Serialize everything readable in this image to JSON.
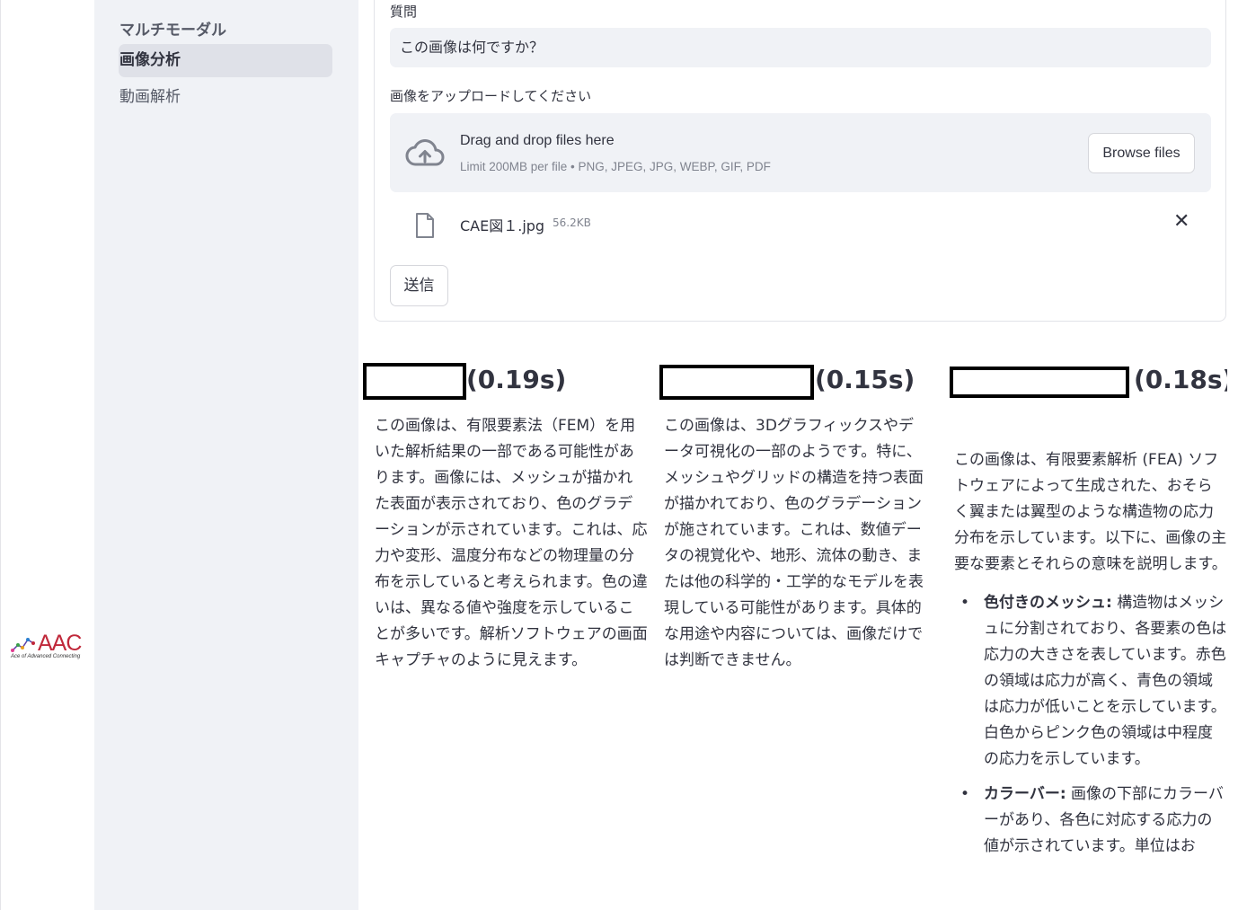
{
  "branding": {
    "logo_text": "AAC",
    "logo_tagline": "Ace of Advanced Connecting"
  },
  "sidebar": {
    "section_heading": "マルチモーダル",
    "items": [
      {
        "label": "画像分析",
        "active": true
      },
      {
        "label": "動画解析",
        "active": false
      }
    ]
  },
  "form": {
    "question_label": "質問",
    "question_value": "この画像は何ですか？",
    "upload_label": "画像をアップロードしてください",
    "dropzone": {
      "main_text": "Drag and drop files here",
      "limit_text": "Limit 200MB per file • PNG, JPEG, JPG, WEBP, GIF, PDF",
      "browse_label": "Browse files",
      "icon": "cloud-upload-icon"
    },
    "uploaded_file": {
      "name": "CAE図１.jpg",
      "size": "56.2KB",
      "icon": "file-icon",
      "remove_icon": "close-icon"
    },
    "submit_label": "送信"
  },
  "results": [
    {
      "timing": "(0.19s)",
      "paragraphs": [
        "この画像は、有限要素法（FEM）を用いた解析結果の一部である可能性があります。画像には、メッシュが描かれた表面が表示されており、色のグラデーションが示されています。これは、応力や変形、温度分布などの物理量の分布を示していると考えられます。色の違いは、異なる値や強度を示していることが多いです。解析ソフトウェアの画面キャプチャのように見えます。"
      ]
    },
    {
      "timing": "(0.15s)",
      "paragraphs": [
        "この画像は、3Dグラフィックスやデータ可視化の一部のようです。特に、メッシュやグリッドの構造を持つ表面が描かれており、色のグラデーションが施されています。これは、数値データの視覚化や、地形、流体の動き、または他の科学的・工学的なモデルを表現している可能性があります。具体的な用途や内容については、画像だけでは判断できません。"
      ]
    },
    {
      "timing": "(0.18s)",
      "paragraphs": [
        "この画像は、有限要素解析 (FEA) ソフトウェアによって生成された、おそらく翼または翼型のような構造物の応力分布を示しています。以下に、画像の主要な要素とそれらの意味を説明します。"
      ],
      "bullets": [
        {
          "term": "色付きのメッシュ:",
          "text": " 構造物はメッシュに分割されており、各要素の色は応力の大きさを表しています。赤色の領域は応力が高く、青色の領域は応力が低いことを示しています。白色からピンク色の領域は中程度の応力を示しています。"
        },
        {
          "term": "カラーバー:",
          "text": " 画像の下部にカラーバーがあり、各色に対応する応力の値が示されています。単位はお"
        }
      ]
    }
  ],
  "colors": {
    "sidebar_bg": "#f0f2f6",
    "active_item_bg": "#dfe1e8",
    "text": "#31333f",
    "muted_text": "#80848f",
    "logo_red": "#c0283a"
  }
}
